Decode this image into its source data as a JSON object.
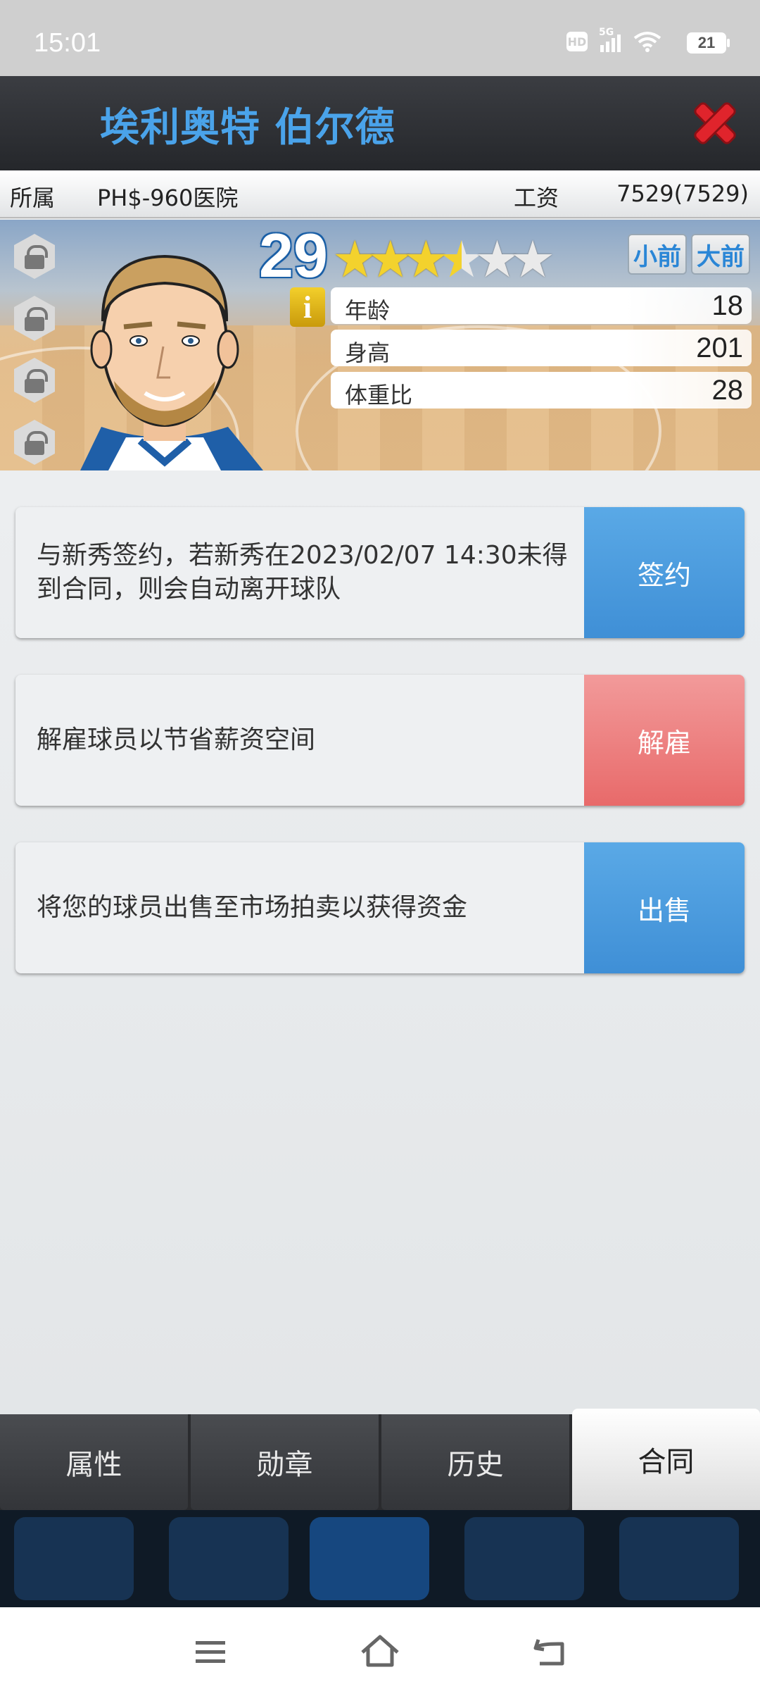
{
  "status_bar": {
    "time": "15:01",
    "network": "5G",
    "hd": "HD",
    "battery": "21"
  },
  "header": {
    "player_name": "埃利奥特 伯尔德"
  },
  "info": {
    "team_label": "所属",
    "team_value": "PH$-960医院",
    "salary_label": "工资",
    "salary_value": "7529(7529)"
  },
  "player": {
    "rating": "29",
    "stars": 3.5,
    "stars_max": 6,
    "positions": [
      "小前",
      "大前"
    ],
    "info_icon": "i",
    "stats": [
      {
        "label": "年龄",
        "value": "18"
      },
      {
        "label": "身高",
        "value": "201"
      },
      {
        "label": "体重比",
        "value": "28"
      }
    ]
  },
  "actions": [
    {
      "description": "与新秀签约，若新秀在2023/02/07 14:30未得到合同，则会自动离开球队",
      "button": "签约",
      "color": "#4a9be0"
    },
    {
      "description": "解雇球员以节省薪资空间",
      "button": "解雇",
      "color": "#ec7c7c"
    },
    {
      "description": "将您的球员出售至市场拍卖以获得资金",
      "button": "出售",
      "color": "#4a9be0"
    }
  ],
  "tabs": [
    {
      "label": "属性",
      "active": false
    },
    {
      "label": "勋章",
      "active": false
    },
    {
      "label": "历史",
      "active": false
    },
    {
      "label": "合同",
      "active": true
    }
  ],
  "nav": {
    "icons": [
      "menu-icon",
      "home-icon",
      "back-icon"
    ]
  }
}
